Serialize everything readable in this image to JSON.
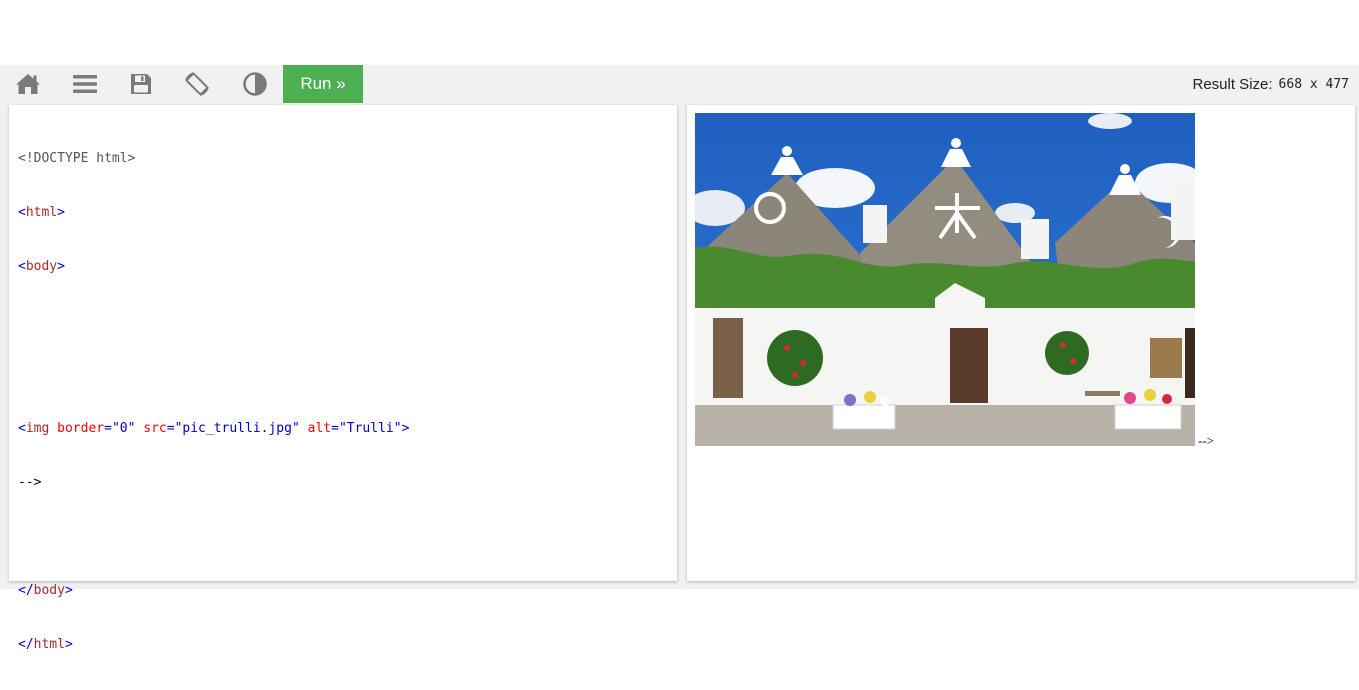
{
  "toolbar": {
    "icons": [
      "home-icon",
      "menu-icon",
      "save-icon",
      "rotate-icon",
      "contrast-icon"
    ],
    "run_label": "Run »",
    "result_size_label": "Result Size:",
    "result_size_value": "668 x 477"
  },
  "code": {
    "doctype": "<!DOCTYPE html>",
    "html_open_lt": "<",
    "html_open_name": "html",
    "html_open_gt": ">",
    "body_open_lt": "<",
    "body_open_name": "body",
    "body_open_gt": ">",
    "img_lt": "<",
    "img_name": "img",
    "img_attr1": " border",
    "img_eq1": "=",
    "img_val1": "\"0\"",
    "img_attr2": " src",
    "img_eq2": "=",
    "img_val2": "\"pic_trulli.jpg\"",
    "img_attr3": " alt",
    "img_eq3": "=",
    "img_val3": "\"Trulli\"",
    "img_gt": ">",
    "comment_end": "-->",
    "body_close_lt": "</",
    "body_close_name": "body",
    "body_close_gt": ">",
    "html_close_lt": "</",
    "html_close_name": "html",
    "html_close_gt": ">"
  },
  "result": {
    "image_alt": "Trulli",
    "trailing_text": "-->"
  },
  "colors": {
    "run_button": "#4caf50",
    "toolbar_bg": "#f1f1f1",
    "tag_name": "#a52a2a",
    "attr_name": "#ff0000",
    "attr_value": "#0000cd"
  }
}
